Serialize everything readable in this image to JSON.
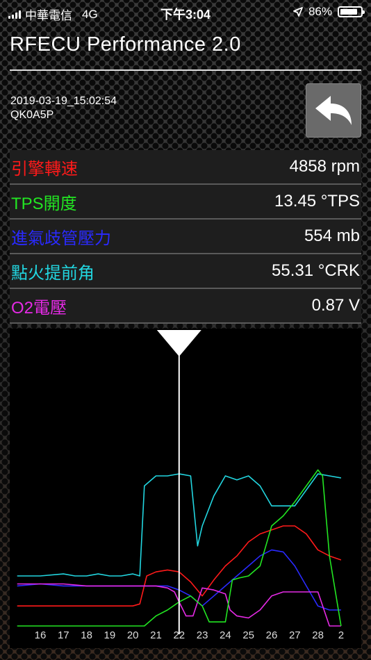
{
  "status_bar": {
    "carrier": "中華電信",
    "network": "4G",
    "time": "下午3:04",
    "battery": "86%",
    "battery_level": 0.86
  },
  "app": {
    "title": "RFECU Performance 2.0",
    "timestamp": "2019-03-19_15:02:54",
    "device_id": "QK0A5P"
  },
  "back_button": {
    "icon": "back-arrow-icon"
  },
  "readings": [
    {
      "label": "引擎轉速",
      "value": "4858 rpm",
      "color": "#ff1a1a"
    },
    {
      "label": "TPS開度",
      "value": "13.45 °TPS",
      "color": "#22e622"
    },
    {
      "label": "進氣歧管壓力",
      "value": "554 mb",
      "color": "#2a2aff"
    },
    {
      "label": "點火提前角",
      "value": "55.31 °CRK",
      "color": "#22d6e0"
    },
    {
      "label": "O2電壓",
      "value": "0.87 V",
      "color": "#e62ae6"
    }
  ],
  "chart_data": {
    "type": "line",
    "x_ticks": [
      "16",
      "17",
      "18",
      "19",
      "20",
      "21",
      "22",
      "23",
      "24",
      "25",
      "26",
      "27",
      "28",
      "2"
    ],
    "cursor_x": 22,
    "series": [
      {
        "color": "#22d6e0",
        "x": [
          15,
          16,
          17,
          17.5,
          18,
          18.5,
          19,
          19.5,
          20,
          20.3,
          20.5,
          21,
          21.5,
          22,
          22.5,
          22.8,
          23,
          23.5,
          24,
          24.5,
          25,
          25.5,
          26,
          26.5,
          27,
          28,
          28.5,
          29
        ],
        "y": [
          0.25,
          0.25,
          0.26,
          0.25,
          0.25,
          0.26,
          0.25,
          0.25,
          0.26,
          0.25,
          0.7,
          0.75,
          0.75,
          0.76,
          0.75,
          0.4,
          0.5,
          0.65,
          0.75,
          0.73,
          0.75,
          0.7,
          0.6,
          0.6,
          0.6,
          0.76,
          0.75,
          0.74
        ]
      },
      {
        "color": "#ff1a1a",
        "x": [
          15,
          16,
          17,
          18,
          19,
          20,
          20.3,
          20.6,
          21,
          21.5,
          22,
          22.5,
          23,
          23.5,
          24,
          24.5,
          25,
          25.5,
          26,
          26.5,
          27,
          27.5,
          28,
          28.5,
          29
        ],
        "y": [
          0.1,
          0.1,
          0.1,
          0.1,
          0.1,
          0.1,
          0.11,
          0.25,
          0.27,
          0.28,
          0.27,
          0.22,
          0.15,
          0.23,
          0.3,
          0.35,
          0.42,
          0.46,
          0.48,
          0.5,
          0.5,
          0.46,
          0.38,
          0.35,
          0.33
        ]
      },
      {
        "color": "#2a2aff",
        "x": [
          15,
          16,
          17,
          18,
          19,
          20,
          21,
          21.5,
          22,
          22.5,
          23,
          23.5,
          24,
          24.5,
          25,
          25.5,
          26,
          26.5,
          27,
          27.5,
          28,
          28.5,
          29
        ],
        "y": [
          0.2,
          0.21,
          0.2,
          0.2,
          0.2,
          0.2,
          0.2,
          0.2,
          0.18,
          0.15,
          0.1,
          0.15,
          0.2,
          0.25,
          0.3,
          0.35,
          0.38,
          0.37,
          0.3,
          0.2,
          0.1,
          0.08,
          0.08
        ]
      },
      {
        "color": "#e62ae6",
        "x": [
          15,
          16,
          17,
          18,
          19,
          20,
          20.5,
          21,
          21.5,
          21.8,
          22,
          22.3,
          22.6,
          23,
          23.5,
          24,
          24.2,
          24.5,
          25,
          25.5,
          26,
          26.5,
          27,
          27.5,
          28,
          28.5,
          29
        ],
        "y": [
          0.21,
          0.21,
          0.21,
          0.2,
          0.2,
          0.2,
          0.2,
          0.2,
          0.19,
          0.17,
          0.12,
          0.05,
          0.05,
          0.19,
          0.18,
          0.16,
          0.08,
          0.05,
          0.04,
          0.08,
          0.15,
          0.17,
          0.17,
          0.17,
          0.17,
          0.0,
          0.0
        ]
      },
      {
        "color": "#22e622",
        "x": [
          15,
          16,
          17,
          18,
          19,
          20,
          20.5,
          21,
          21.5,
          22,
          22.5,
          23,
          23.3,
          24,
          24.3,
          24.6,
          25,
          25.5,
          26,
          26.5,
          27,
          27.5,
          28,
          28.2,
          28.5,
          29
        ],
        "y": [
          0.0,
          0.0,
          0.0,
          0.0,
          0.0,
          0.0,
          0.0,
          0.05,
          0.08,
          0.12,
          0.15,
          0.1,
          0.02,
          0.02,
          0.23,
          0.24,
          0.25,
          0.3,
          0.5,
          0.55,
          0.62,
          0.7,
          0.78,
          0.75,
          0.35,
          0.0
        ]
      }
    ]
  }
}
